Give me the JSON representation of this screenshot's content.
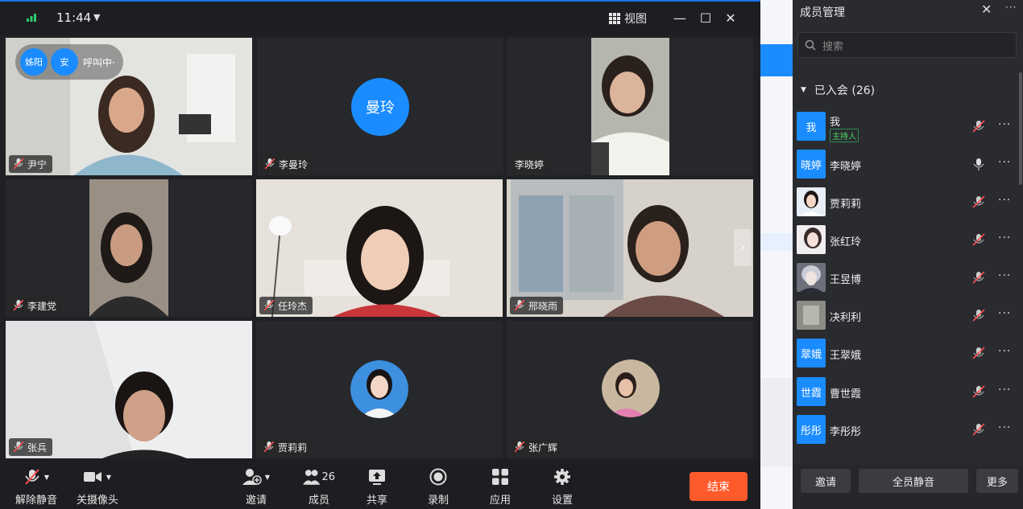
{
  "titlebar": {
    "time": "11:44",
    "view_label": "视图"
  },
  "calling": {
    "bubbles": [
      "姊阳",
      "安"
    ],
    "status": "呼叫中·"
  },
  "tiles": [
    {
      "name": "尹宁",
      "kind": "video"
    },
    {
      "name": "李曼玲",
      "kind": "avatar",
      "avatar_text": "曼玲"
    },
    {
      "name": "李晓婷",
      "kind": "video"
    },
    {
      "name": "李建党",
      "kind": "video"
    },
    {
      "name": "任玲杰",
      "kind": "video"
    },
    {
      "name": "邢晓雨",
      "kind": "video"
    },
    {
      "name": "张兵",
      "kind": "video"
    },
    {
      "name": "贾莉莉",
      "kind": "photo"
    },
    {
      "name": "张广辉",
      "kind": "photo"
    }
  ],
  "toolbar": {
    "unmute": "解除静音",
    "camera": "关摄像头",
    "invite": "邀请",
    "members": "成员",
    "members_count": "26",
    "share": "共享",
    "record": "录制",
    "apps": "应用",
    "settings": "设置",
    "end": "结束"
  },
  "panel": {
    "title": "成员管理",
    "search_placeholder": "搜索",
    "group_label": "已入会 (26)",
    "host_badge": "主持人",
    "members": [
      {
        "name": "我",
        "avatar": "我",
        "mic": "muted",
        "host": true
      },
      {
        "name": "李晓婷",
        "avatar": "晓婷",
        "mic": "on"
      },
      {
        "name": "贾莉莉",
        "avatar": "",
        "mic": "muted"
      },
      {
        "name": "张红玲",
        "avatar": "",
        "mic": "muted"
      },
      {
        "name": "王昱博",
        "avatar": "",
        "mic": "muted"
      },
      {
        "name": "决利利",
        "avatar": "",
        "mic": "muted"
      },
      {
        "name": "王翠娥",
        "avatar": "翠娥",
        "mic": "muted"
      },
      {
        "name": "曹世霞",
        "avatar": "世霞",
        "mic": "muted"
      },
      {
        "name": "李彤彤",
        "avatar": "彤彤",
        "mic": "muted"
      }
    ],
    "buttons": {
      "invite": "邀请",
      "mute_all": "全员静音",
      "more": "更多"
    }
  },
  "colors": {
    "accent": "#1a8cff",
    "end": "#ff5a2b",
    "host": "#4cd964"
  }
}
